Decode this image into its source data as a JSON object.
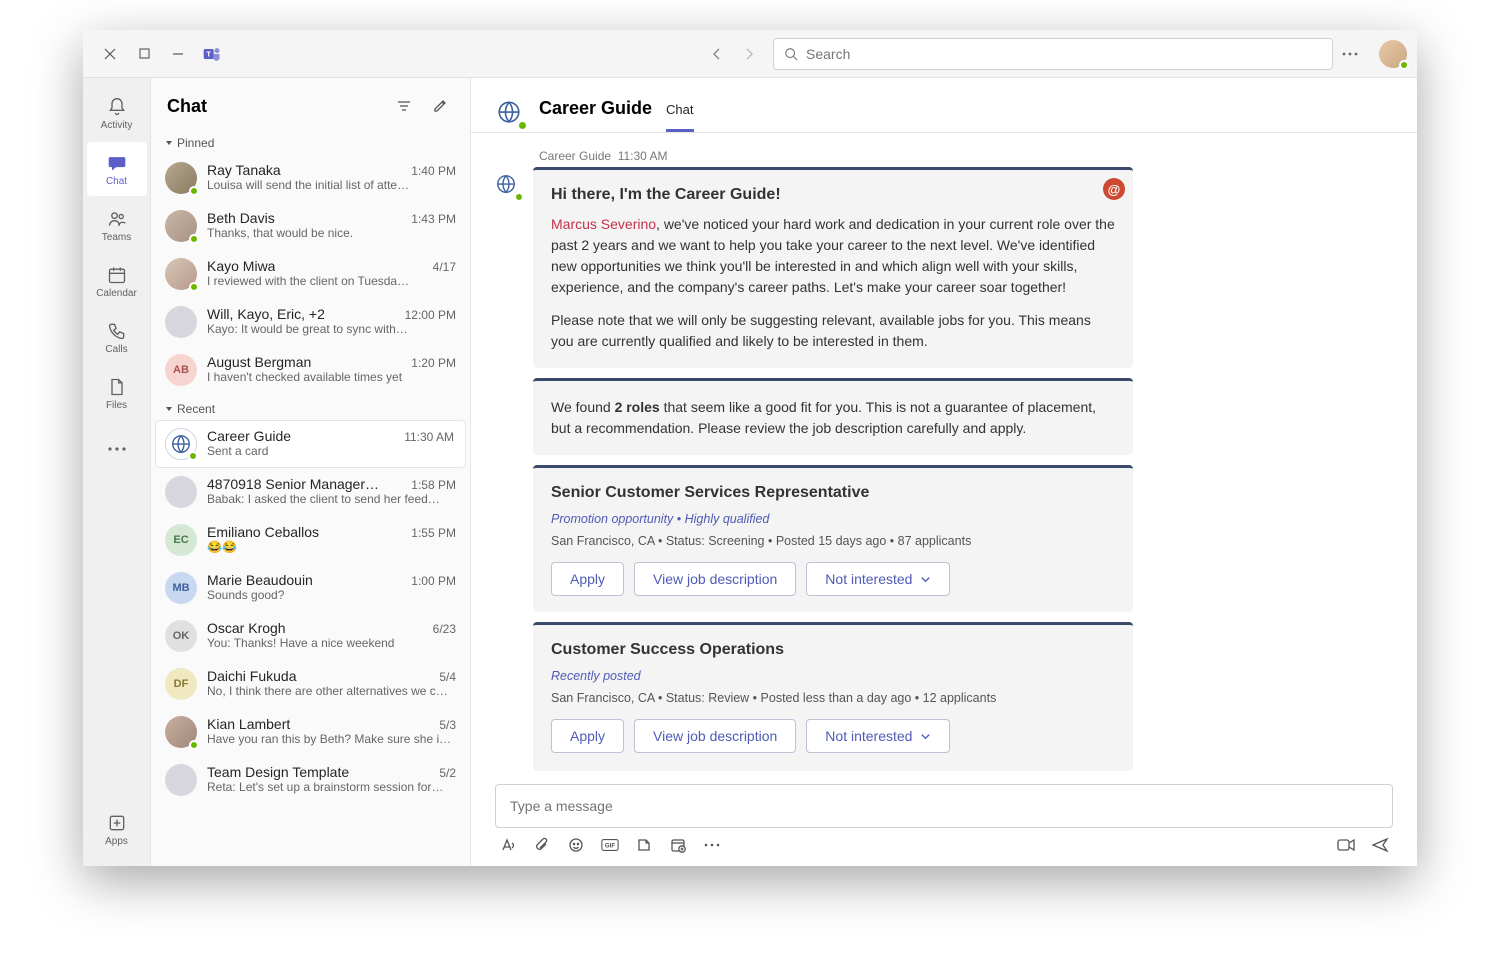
{
  "window": {
    "search_placeholder": "Search"
  },
  "rail": {
    "items": [
      {
        "label": "Activity"
      },
      {
        "label": "Chat"
      },
      {
        "label": "Teams"
      },
      {
        "label": "Calendar"
      },
      {
        "label": "Calls"
      },
      {
        "label": "Files"
      }
    ],
    "apps_label": "Apps"
  },
  "chatlist": {
    "title": "Chat",
    "sections": {
      "pinned": "Pinned",
      "recent": "Recent"
    },
    "pinned": [
      {
        "name": "Ray Tanaka",
        "time": "1:40 PM",
        "preview": "Louisa will send the initial list of atte…",
        "initials": ""
      },
      {
        "name": "Beth Davis",
        "time": "1:43 PM",
        "preview": "Thanks, that would be nice.",
        "initials": ""
      },
      {
        "name": "Kayo Miwa",
        "time": "4/17",
        "preview": "I reviewed with the client on Tuesda…",
        "initials": ""
      },
      {
        "name": "Will, Kayo, Eric, +2",
        "time": "12:00 PM",
        "preview": "Kayo: It would be great to sync with…",
        "initials": ""
      },
      {
        "name": "August Bergman",
        "time": "1:20 PM",
        "preview": "I haven't checked available times yet",
        "initials": "AB"
      }
    ],
    "recent": [
      {
        "name": "Career Guide",
        "time": "11:30 AM",
        "preview": "Sent a card",
        "globe": true
      },
      {
        "name": "4870918 Senior Manager…",
        "time": "1:58 PM",
        "preview": "Babak: I asked the client to send her feed…",
        "initials": ""
      },
      {
        "name": "Emiliano Ceballos",
        "time": "1:55 PM",
        "preview": "😂😂",
        "initials": "EC"
      },
      {
        "name": "Marie Beaudouin",
        "time": "1:00 PM",
        "preview": "Sounds good?",
        "initials": "MB"
      },
      {
        "name": "Oscar Krogh",
        "time": "6/23",
        "preview": "You: Thanks! Have a nice weekend",
        "initials": "OK"
      },
      {
        "name": "Daichi Fukuda",
        "time": "5/4",
        "preview": "No, I think there are other alternatives we c…",
        "initials": "DF"
      },
      {
        "name": "Kian Lambert",
        "time": "5/3",
        "preview": "Have you ran this by Beth? Make sure she is…",
        "initials": ""
      },
      {
        "name": "Team Design Template",
        "time": "5/2",
        "preview": "Reta: Let's set up a brainstorm session for…",
        "initials": ""
      }
    ]
  },
  "chat": {
    "title": "Career Guide",
    "tab": "Chat",
    "sender": "Career Guide",
    "time": "11:30 AM",
    "card1": {
      "heading": "Hi there, I'm the Career Guide!",
      "mention": "Marcus Severino",
      "body1": ", we've noticed your hard work and dedication in your current role over the past 2 years and we want to help you take your career to the next level. We've identified new opportunities we think you'll be interested in and which align well with your skills, experience, and the company's career paths. Let's make your career soar together!",
      "body2": "Please note that we will only be suggesting relevant, available jobs for you. This means you are currently qualified and likely to be interested in them."
    },
    "card2": {
      "prefix": "We found ",
      "bold": "2 roles",
      "suffix": " that seem like a good fit for you. This is not a guarantee of placement, but a recommendation. Please review the job description carefully and apply."
    },
    "job1": {
      "title": "Senior Customer Services Representative",
      "sub": "Promotion opportunity  •  Highly qualified",
      "meta": "San Francisco, CA • Status: Screening • Posted 15 days ago • 87 applicants",
      "btn_apply": "Apply",
      "btn_view": "View job description",
      "btn_no": "Not interested"
    },
    "job2": {
      "title": "Customer Success Operations",
      "sub": "Recently posted",
      "meta": "San Francisco, CA • Status: Review • Posted less than a day ago • 12 applicants",
      "btn_apply": "Apply",
      "btn_view": "View job description",
      "btn_no": "Not interested"
    }
  },
  "composer": {
    "placeholder": "Type a message"
  },
  "colors": {
    "accent": "#5b5fc7",
    "card_border": "#3b4a6b",
    "mention": "#c4314b"
  }
}
